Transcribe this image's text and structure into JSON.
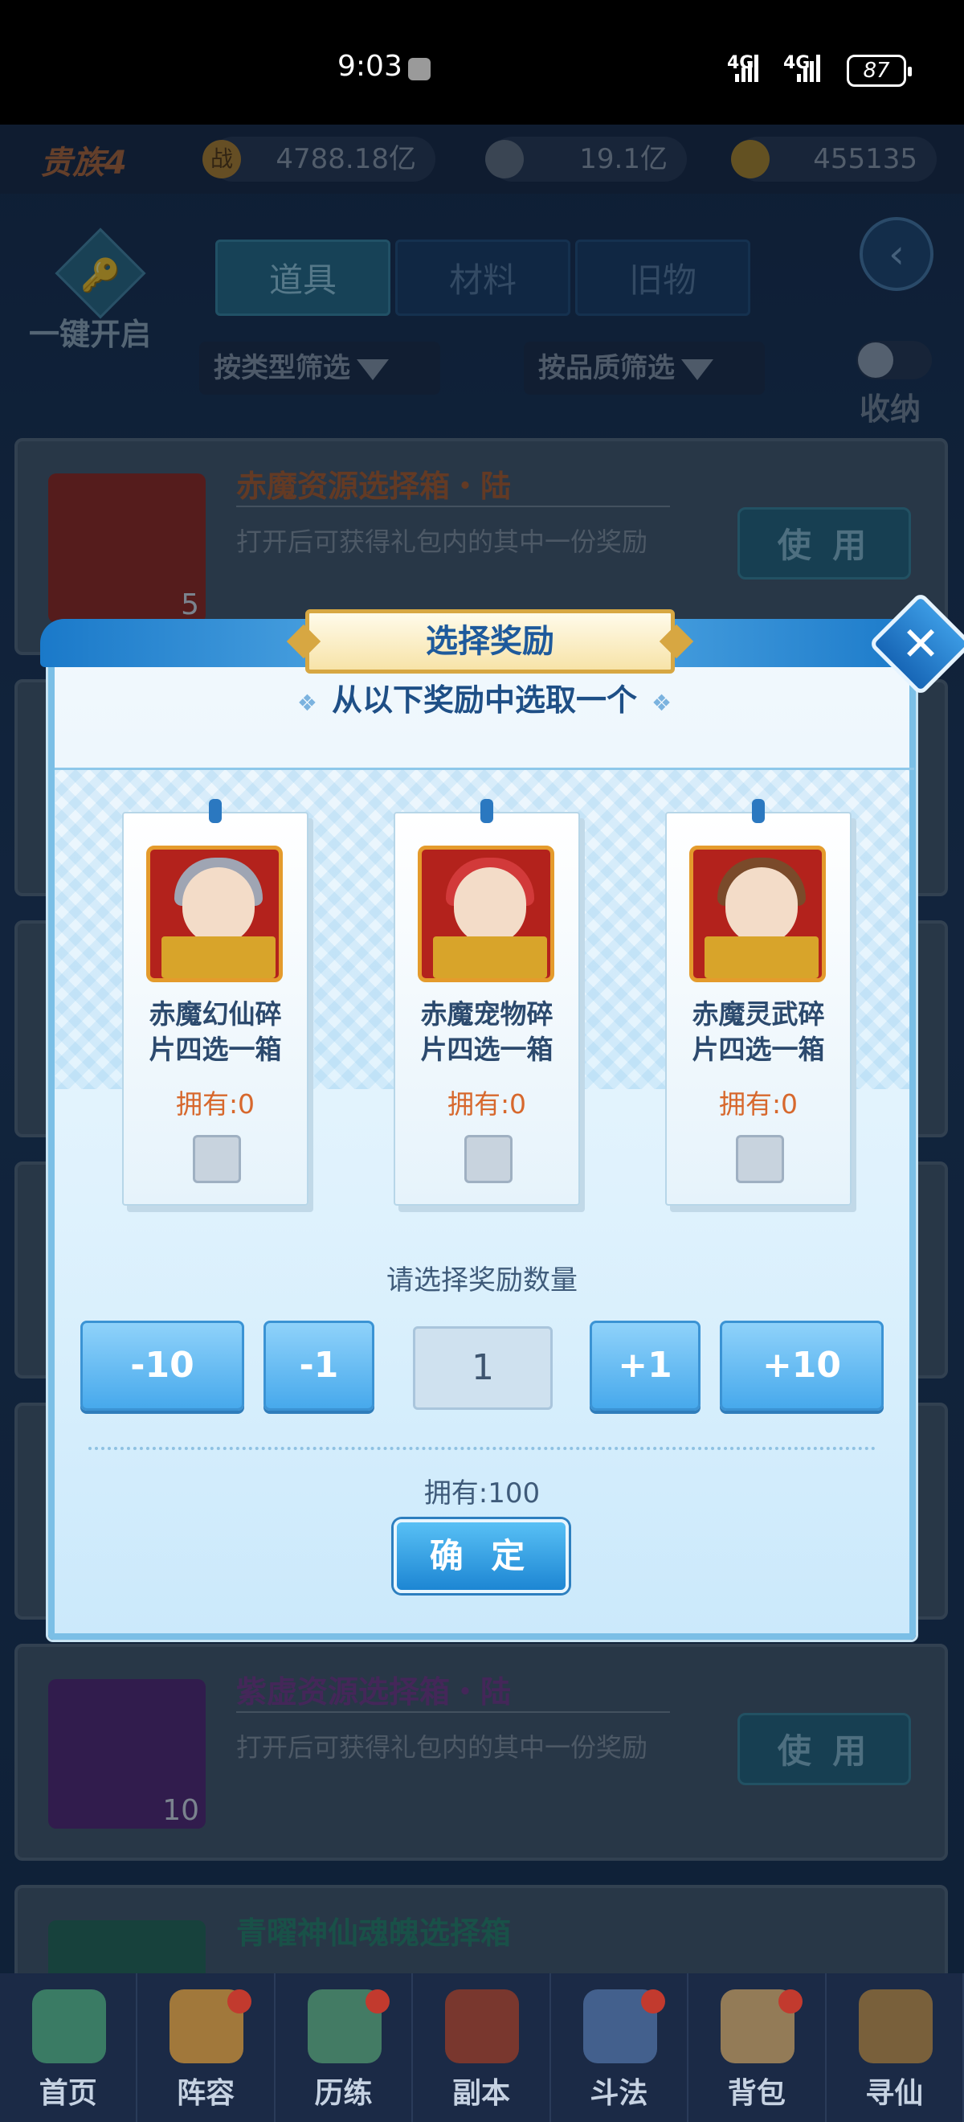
{
  "status_bar": {
    "time": "9:03",
    "network1": "4G",
    "network2": "4G",
    "battery": "87"
  },
  "header": {
    "noble_rank": "贵族4",
    "power_icon_glyph": "战",
    "power_value": "4788.18亿",
    "coin_value": "19.1亿",
    "gold_value": "455135"
  },
  "toolbar": {
    "one_click_open": "一键开启",
    "key_glyph": "🔑",
    "tabs": [
      "道具",
      "材料",
      "旧物"
    ],
    "active_tab": "道具",
    "filter_type": "按类型筛选",
    "filter_quality": "按品质筛选",
    "collapse_label": "收纳"
  },
  "items": [
    {
      "title": "赤魔资源选择箱・陆",
      "desc": "打开后可获得礼包内的其中一份奖励",
      "count": "5",
      "button": "使 用",
      "title_color": "#b5622f",
      "icon_color": "#9b2b1f"
    },
    {
      "title": "紫虚资源选择箱・陆",
      "desc": "打开后可获得礼包内的其中一份奖励",
      "count": "10",
      "button": "使 用",
      "title_color": "#7d3f8f",
      "icon_color": "#5a2a78"
    },
    {
      "title": "青曜神仙魂魄选择箱",
      "desc": "",
      "count": "",
      "button": "",
      "title_color": "#2f8a70",
      "icon_color": "#2a6e5a"
    }
  ],
  "dialog": {
    "title": "选择奖励",
    "prompt": "从以下奖励中选取一个",
    "close_glyph": "✕",
    "rewards": [
      {
        "name_line1": "赤魔幻仙碎",
        "name_line2": "片四选一箱",
        "owned": "拥有:0",
        "hair_color": "#9fa5b3"
      },
      {
        "name_line1": "赤魔宠物碎",
        "name_line2": "片四选一箱",
        "owned": "拥有:0",
        "hair_color": "#d23a3a"
      },
      {
        "name_line1": "赤魔灵武碎",
        "name_line2": "片四选一箱",
        "owned": "拥有:0",
        "hair_color": "#7a4a2a"
      }
    ],
    "quantity_label": "请选择奖励数量",
    "minus10": "-10",
    "minus1": "-1",
    "quantity": "1",
    "plus1": "+1",
    "plus10": "+10",
    "owned_total": "拥有:100",
    "confirm": "确 定"
  },
  "nav": [
    "首页",
    "阵容",
    "历练",
    "副本",
    "斗法",
    "背包",
    "寻仙"
  ],
  "colors": {
    "accent_blue": "#47a9ec",
    "dialog_border": "#7bbfe6",
    "owned_orange": "#d7682d"
  }
}
